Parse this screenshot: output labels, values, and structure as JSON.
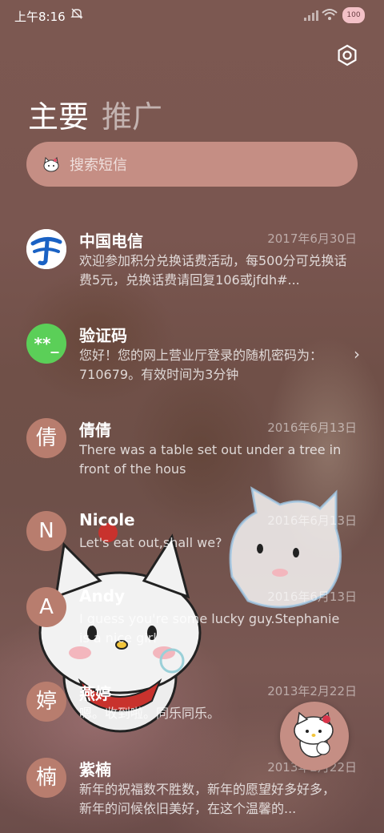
{
  "status_bar": {
    "time": "上午8:16",
    "battery": "100"
  },
  "tabs": [
    {
      "label": "主要"
    },
    {
      "label": "推广"
    }
  ],
  "search": {
    "placeholder": "搜索短信"
  },
  "messages": [
    {
      "avatar_text": "",
      "avatar_type": "telecom-logo",
      "name": "中国电信",
      "date": "2017年6月30日",
      "preview": "欢迎参加积分兑换话费活动，每500分可兑换话费5元，兑换话费请回复106或jfdh#..."
    },
    {
      "avatar_text": "**_",
      "avatar_type": "code",
      "name": "验证码",
      "date": "",
      "preview": "您好！您的网上营业厅登录的随机密码为：710679。有效时间为3分钟"
    },
    {
      "avatar_text": "倩",
      "avatar_type": "letter",
      "name": "倩倩",
      "date": "2016年6月13日",
      "preview": "There was a table set out under a tree in front of the hous"
    },
    {
      "avatar_text": "N",
      "avatar_type": "letter",
      "name": "Nicole",
      "date": "2016年6月13日",
      "preview": "Let's eat out,shall we?"
    },
    {
      "avatar_text": "A",
      "avatar_type": "letter",
      "name": "Andy",
      "date": "2016年6月13日",
      "preview": "I guess you're some lucky guy.Stephanie is a nice girl"
    },
    {
      "avatar_text": "婷",
      "avatar_type": "letter",
      "name": "燕婷",
      "date": "2013年2月22日",
      "preview": "嗯。收到啦。同乐同乐。"
    },
    {
      "avatar_text": "楠",
      "avatar_type": "letter",
      "name": "紫楠",
      "date": "2013年2月22日",
      "preview": "新年的祝福数不胜数，新年的愿望好多好多，新年的问候依旧美好，在这个温馨的..."
    }
  ],
  "colors": {
    "accent": "#c58e84",
    "avatar": "#b87d6e",
    "code_avatar": "#5bcf58",
    "telecom_blue": "#1a62c4"
  },
  "icons": {
    "settings": "gear-icon",
    "search_prefix": "hello-kitty-icon",
    "fab": "hello-kitty-compose-icon"
  }
}
